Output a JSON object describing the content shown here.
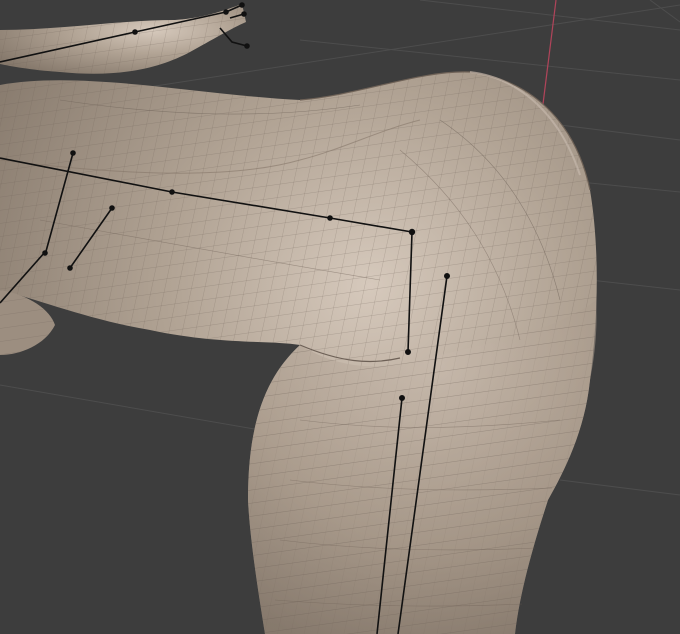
{
  "viewport": {
    "kind": "3d-viewport",
    "shading": "wireframe-overlay",
    "colors": {
      "background": "#3d3d3d",
      "grid_line": "#4a4a4a",
      "axis_y": "#b0445a",
      "mesh_base": "#a99a8c",
      "mesh_light": "#d2c5b8",
      "mesh_shadow": "#7a6c60",
      "wire": "#6c5f55",
      "bone": "#111111"
    }
  }
}
